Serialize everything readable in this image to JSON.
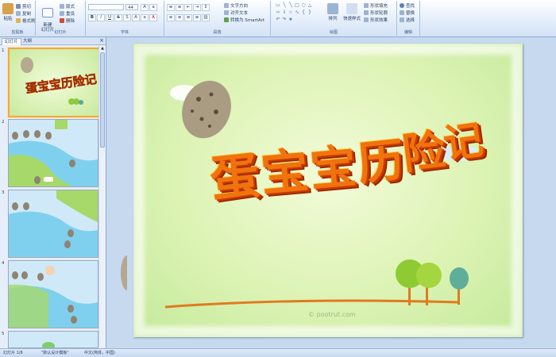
{
  "ribbon": {
    "clipboard": {
      "paste": "粘贴",
      "cut": "剪切",
      "copy": "复制",
      "format_painter": "格式刷",
      "label": "剪贴板"
    },
    "slides": {
      "new_slide": "新建\n幻灯片",
      "layout": "版式",
      "reset": "重设",
      "delete": "删除",
      "label": "幻灯片"
    },
    "font": {
      "size": "44",
      "label": "字体"
    },
    "paragraph": {
      "text_direction": "文字方向",
      "align_text": "对齐文本",
      "smartart": "转换为 SmartArt",
      "label": "段落"
    },
    "drawing": {
      "arrange": "排列",
      "quick_styles": "快速样式",
      "shape_fill": "形状填充",
      "shape_outline": "形状轮廓",
      "shape_effects": "形状效果",
      "label": "绘图"
    },
    "editing": {
      "find": "查找",
      "replace": "替换",
      "select": "选择",
      "label": "编辑"
    }
  },
  "panel": {
    "tab_slides": "幻灯片",
    "tab_outline": "大纲",
    "close": "×"
  },
  "thumbs": [
    {
      "num": "1"
    },
    {
      "num": "2"
    },
    {
      "num": "3"
    },
    {
      "num": "4"
    },
    {
      "num": "5"
    }
  ],
  "slide": {
    "title_chars": [
      "蛋",
      "宝",
      "宝",
      "历",
      "险",
      "记"
    ],
    "watermark": "© pootrut.com"
  },
  "status": {
    "slide_count": "幻灯片 1/6",
    "theme": "\"默认设计模板\"",
    "language": "中文(简体，中国)"
  },
  "colors": {
    "title": "#f0730e",
    "accent": "#f4a73d"
  }
}
